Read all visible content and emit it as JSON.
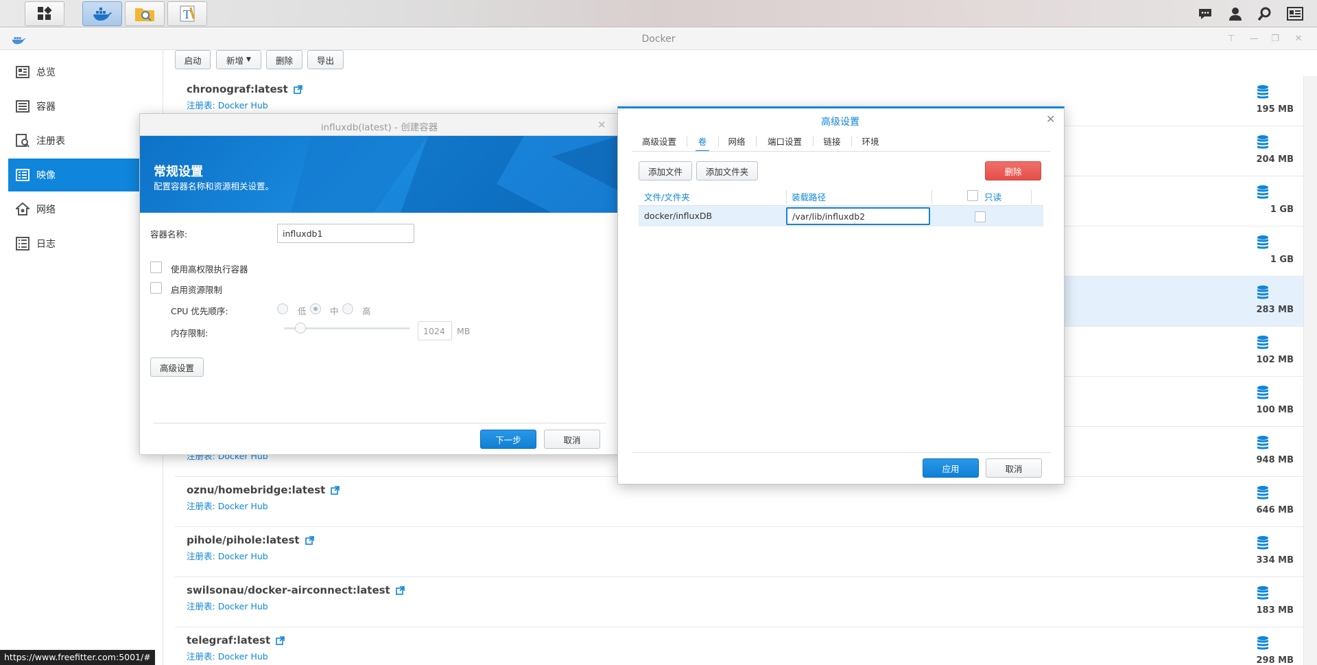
{
  "app": {
    "title": "Docker"
  },
  "sidebar": {
    "items": [
      {
        "label": "总览",
        "icon": "overview-icon"
      },
      {
        "label": "容器",
        "icon": "container-icon"
      },
      {
        "label": "注册表",
        "icon": "registry-icon"
      },
      {
        "label": "映像",
        "icon": "image-icon"
      },
      {
        "label": "网络",
        "icon": "network-icon"
      },
      {
        "label": "日志",
        "icon": "log-icon"
      }
    ],
    "selected": "映像"
  },
  "toolbar": {
    "start": "启动",
    "new": "新增",
    "delete": "删除",
    "export": "导出"
  },
  "images": [
    {
      "name": "chronograf:latest",
      "registry_label": "注册表:",
      "registry": "Docker Hub",
      "size": "195 MB"
    },
    {
      "name": "",
      "registry_label": "",
      "registry": "",
      "size": "204 MB"
    },
    {
      "name": "",
      "registry_label": "",
      "registry": "",
      "size": "1 GB"
    },
    {
      "name": "",
      "registry_label": "",
      "registry": "",
      "size": "1 GB"
    },
    {
      "name": "",
      "registry_label": "",
      "registry": "",
      "size": "283 MB"
    },
    {
      "name": "",
      "registry_label": "",
      "registry": "",
      "size": "102 MB"
    },
    {
      "name": "",
      "registry_label": "",
      "registry": "",
      "size": "100 MB"
    },
    {
      "name": "",
      "registry_label": "注册表:",
      "registry": "Docker Hub",
      "size": "948 MB"
    },
    {
      "name": "oznu/homebridge:latest",
      "registry_label": "注册表:",
      "registry": "Docker Hub",
      "size": "646 MB"
    },
    {
      "name": "pihole/pihole:latest",
      "registry_label": "注册表:",
      "registry": "Docker Hub",
      "size": "334 MB"
    },
    {
      "name": "swilsonau/docker-airconnect:latest",
      "registry_label": "注册表:",
      "registry": "Docker Hub",
      "size": "183 MB"
    },
    {
      "name": "telegraf:latest",
      "registry_label": "注册表:",
      "registry": "Docker Hub",
      "size": "298 MB"
    }
  ],
  "create_dialog": {
    "title": "influxdb(latest) - 创建容器",
    "banner_title": "常规设置",
    "banner_subtitle": "配置容器名称和资源相关设置。",
    "container_name_label": "容器名称:",
    "container_name_value": "influxdb1",
    "privileged_label": "使用高权限执行容器",
    "resource_limit_label": "启用资源限制",
    "cpu_priority_label": "CPU 优先顺序:",
    "cpu_options": [
      "低",
      "中",
      "高"
    ],
    "memory_label": "内存限制:",
    "memory_value": "1024",
    "memory_unit": "MB",
    "advanced_button": "高级设置",
    "next_button": "下一步",
    "cancel_button": "取消"
  },
  "advanced_dialog": {
    "title": "高级设置",
    "tabs": [
      "高级设置",
      "卷",
      "网络",
      "端口设置",
      "链接",
      "环境"
    ],
    "selected_tab": "卷",
    "add_file": "添加文件",
    "add_folder": "添加文件夹",
    "delete": "删除",
    "columns": [
      "文件/文件夹",
      "装载路径",
      "只读"
    ],
    "rows": [
      {
        "folder": "docker/influxDB",
        "mount_path": "/var/lib/influxdb2",
        "readonly": false
      }
    ],
    "apply": "应用",
    "cancel": "取消"
  },
  "status_url": "https://www.freefitter.com:5001/#",
  "colors": {
    "accent": "#0f85db",
    "danger": "#e54e48"
  }
}
